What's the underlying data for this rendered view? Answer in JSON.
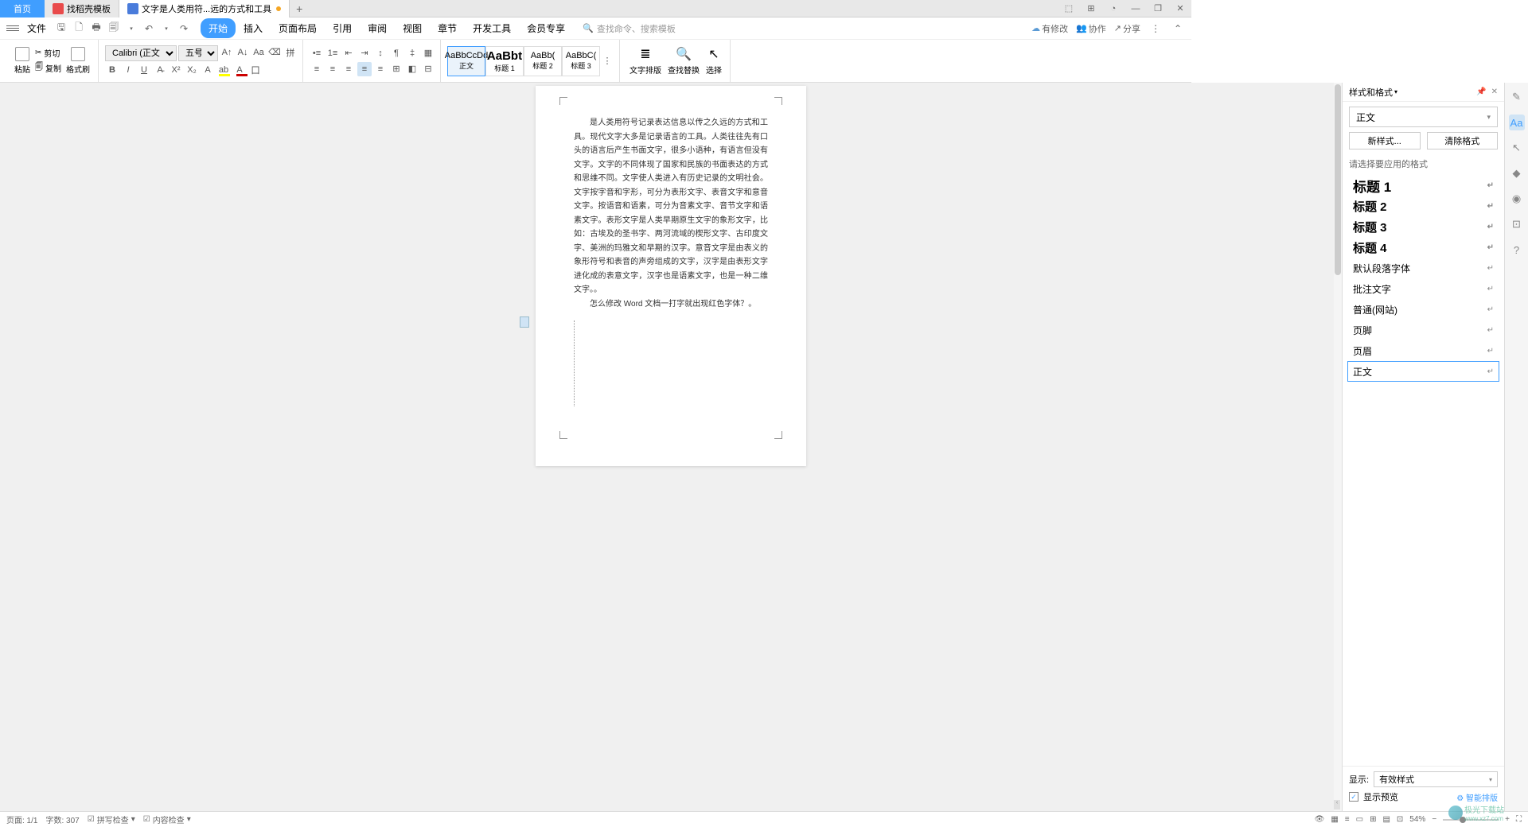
{
  "tabs": {
    "home": "首页",
    "template": "找稻壳模板",
    "doc": "文字是人类用符...远的方式和工具"
  },
  "menubar": {
    "file": "文件",
    "items": [
      "开始",
      "插入",
      "页面布局",
      "引用",
      "审阅",
      "视图",
      "章节",
      "开发工具",
      "会员专享"
    ],
    "search_placeholder": "查找命令、搜索模板",
    "right": {
      "changes": "有修改",
      "collab": "协作",
      "share": "分享"
    }
  },
  "ribbon": {
    "paste": "粘贴",
    "cut": "剪切",
    "copy": "复制",
    "format_painter": "格式刷",
    "font_name": "Calibri (正文)",
    "font_size": "五号",
    "styles": [
      {
        "sample": "AaBbCcDd",
        "label": "正文"
      },
      {
        "sample": "AaBbt",
        "label": "标题 1"
      },
      {
        "sample": "AaBb(",
        "label": "标题 2"
      },
      {
        "sample": "AaBbC(",
        "label": "标题 3"
      }
    ],
    "text_layout": "文字排版",
    "find_replace": "查找替换",
    "select": "选择"
  },
  "document": {
    "para1": "是人类用符号记录表达信息以传之久远的方式和工具。现代文字大多是记录语言的工具。人类往往先有口头的语言后产生书面文字，很多小语种，有语言但没有文字。文字的不同体现了国家和民族的书面表达的方式和思维不同。文字使人类进入有历史记录的文明社会。文字按字音和字形，可分为表形文字、表音文字和意音文字。按语音和语素，可分为音素文字、音节文字和语素文字。表形文字是人类早期原生文字的象形文字，比如：古埃及的圣书字、两河流域的楔形文字、古印度文字、美洲的玛雅文和早期的汉字。意音文字是由表义的象形符号和表音的声旁组成的文字，汉字是由表形文字进化成的表意文字，汉字也是语素文字，也是一种二维文字。。",
    "para2": "怎么修改 Word 文档一打字就出现红色字体？。"
  },
  "panel": {
    "title": "样式和格式",
    "current": "正文",
    "new_style": "新样式...",
    "clear_format": "清除格式",
    "hint": "请选择要应用的格式",
    "items": [
      {
        "label": "标题 1",
        "cls": "heading h1"
      },
      {
        "label": "标题 2",
        "cls": "heading"
      },
      {
        "label": "标题 3",
        "cls": "heading"
      },
      {
        "label": "标题 4",
        "cls": "heading"
      },
      {
        "label": "默认段落字体",
        "cls": ""
      },
      {
        "label": "批注文字",
        "cls": ""
      },
      {
        "label": "普通(网站)",
        "cls": ""
      },
      {
        "label": "页脚",
        "cls": ""
      },
      {
        "label": "页眉",
        "cls": ""
      },
      {
        "label": "正文",
        "cls": "selected"
      }
    ],
    "show_label": "显示:",
    "show_value": "有效样式",
    "preview": "显示预览",
    "smart": "智能排版"
  },
  "status": {
    "page": "页面: 1/1",
    "words": "字数: 307",
    "spell": "拼写检查",
    "content": "内容检查",
    "zoom": "54%"
  },
  "watermark": {
    "line1": "极光下载站",
    "line2": "www.xz7.com"
  }
}
